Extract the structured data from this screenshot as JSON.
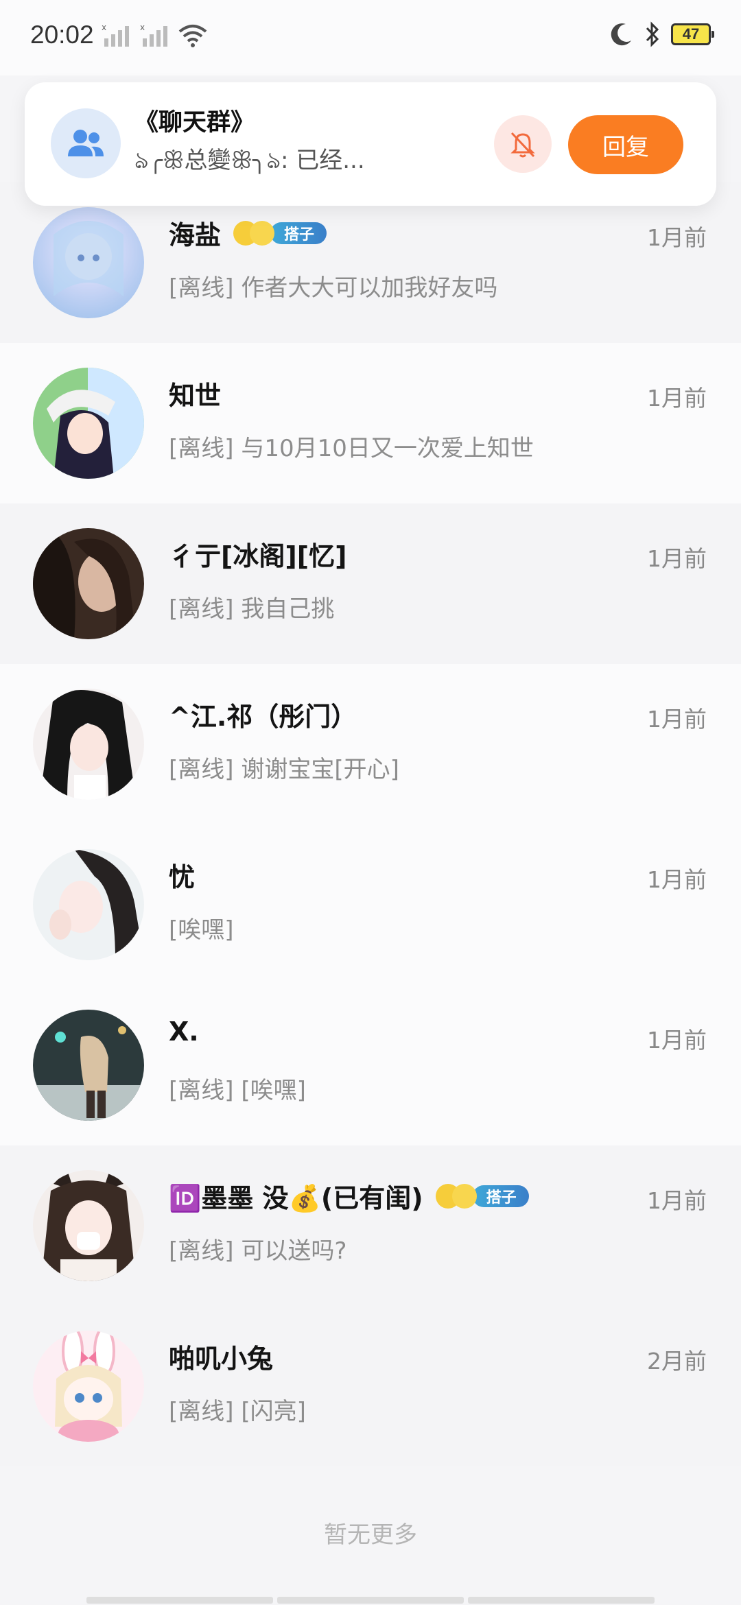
{
  "status_bar": {
    "time": "20:02",
    "battery": "47"
  },
  "group_card": {
    "title": "《聊天群》",
    "preview": "ঌ╭ꕥ总變ꕥ╮ঌ: 已经...",
    "reply_label": "回复"
  },
  "conversations": [
    {
      "name": "海盐",
      "badge": "搭子",
      "time": "1月前",
      "message": "[离线] 作者大大可以加我好友吗"
    },
    {
      "name": "知世",
      "badge": "",
      "time": "1月前",
      "message": "[离线] 与10月10日又一次爱上知世"
    },
    {
      "name": "彳亍[冰阁][忆]",
      "badge": "",
      "time": "1月前",
      "message": "[离线] 我自己挑"
    },
    {
      "name": "^江.祁（彤门）",
      "badge": "",
      "time": "1月前",
      "message": "[离线] 谢谢宝宝[开心]"
    },
    {
      "name": "忧",
      "badge": "",
      "time": "1月前",
      "message": "[唉嘿]"
    },
    {
      "name": "X.",
      "badge": "",
      "time": "1月前",
      "message": "[离线] [唉嘿]"
    },
    {
      "name": "🆔墨墨 没💰(已有闺)",
      "badge": "搭子",
      "time": "1月前",
      "message": "[离线] 可以送吗?"
    },
    {
      "name": "啪叽小兔",
      "badge": "",
      "time": "2月前",
      "message": "[离线] [闪亮]"
    }
  ],
  "footer": "暂无更多",
  "colors": {
    "accent": "#fa7d22",
    "badge": "#3a8fd0"
  }
}
